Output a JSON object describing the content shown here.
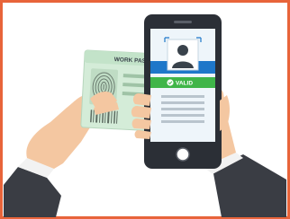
{
  "card": {
    "title": "WORK PASS"
  },
  "phone": {
    "status_label": "VALID",
    "status_color": "#3fb549",
    "header_color": "#1e77c9"
  },
  "frame": {
    "border_color": "#e8643a"
  },
  "icons": {
    "fingerprint": "fingerprint-icon",
    "avatar": "user-avatar-icon",
    "check": "check-circle-icon",
    "home": "home-button-icon"
  }
}
